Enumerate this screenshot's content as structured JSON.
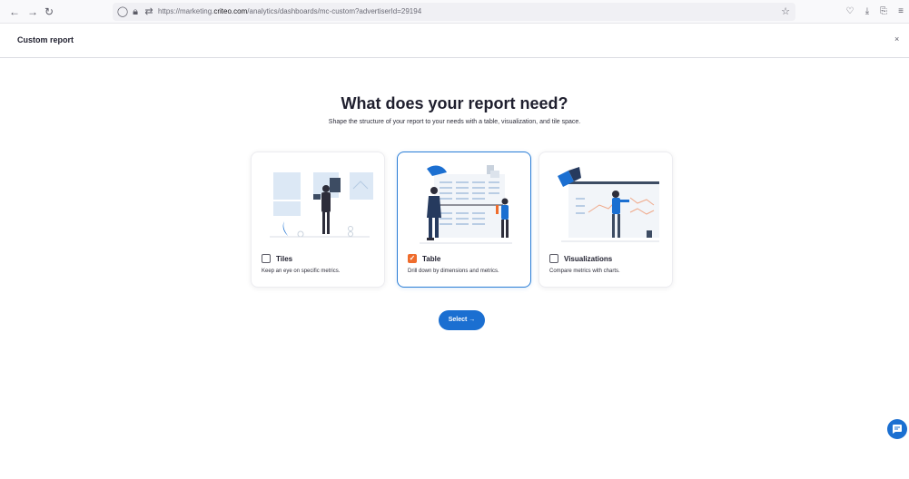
{
  "browser": {
    "url_prefix": "https://marketing.",
    "url_domain": "criteo.com",
    "url_path": "/analytics/dashboards/mc-custom?advertiserId=29194",
    "icons": [
      "back-arrow-icon",
      "forward-arrow-icon",
      "reload-icon",
      "shield-icon",
      "lock-icon",
      "permissions-icon",
      "star-icon",
      "pocket-icon",
      "download-icon",
      "extensions-icon",
      "menu-icon"
    ]
  },
  "header": {
    "title": "Custom report",
    "close_label": "×"
  },
  "main": {
    "heading": "What does your report need?",
    "subheading": "Shape the structure of your report to your needs with a table, visualization, and tile space.",
    "options": [
      {
        "label": "Tiles",
        "description": "Keep an eye on specific metrics.",
        "checked": false
      },
      {
        "label": "Table",
        "description": "Drill down by dimensions and metrics.",
        "checked": true
      },
      {
        "label": "Visualizations",
        "description": "Compare metrics with charts.",
        "checked": false
      }
    ],
    "select_label": "Select →"
  },
  "colors": {
    "accent": "#1b6fd1",
    "checkbox_checked": "#ef6c2c",
    "selected_border": "#2a7dd6"
  }
}
